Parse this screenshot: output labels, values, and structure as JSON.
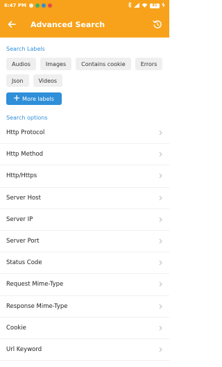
{
  "status_bar": {
    "time": "6:47 PM",
    "battery": "81",
    "icons": [
      "notification-dot-icon",
      "app-dot-icon",
      "app-dot-icon",
      "app-dot-icon"
    ],
    "right_icons": [
      "bluetooth-icon",
      "signal-icon",
      "wifi-icon",
      "battery-icon",
      "charging-icon"
    ]
  },
  "app_bar": {
    "title": "Advanced Search",
    "back_icon": "arrow-left-icon",
    "reset_icon": "reset-history-icon",
    "color": "#f7a21a"
  },
  "search_labels": {
    "section_title": "Search Labels",
    "chips": [
      "Audios",
      "Images",
      "Contains cookie",
      "Errors",
      "Json",
      "Videos"
    ],
    "more_button": "More labels",
    "more_icon": "plus-icon",
    "accent": "#2f8fd8"
  },
  "search_options": {
    "section_title": "Search options",
    "items": [
      "Http Protocol",
      "Http Method",
      "Http/Https",
      "Server Host",
      "Server IP",
      "Server Port",
      "Status Code",
      "Request Mime-Type",
      "Response Mime-Type",
      "Cookie",
      "Url Keyword"
    ],
    "chevron_icon": "chevron-right-icon"
  }
}
